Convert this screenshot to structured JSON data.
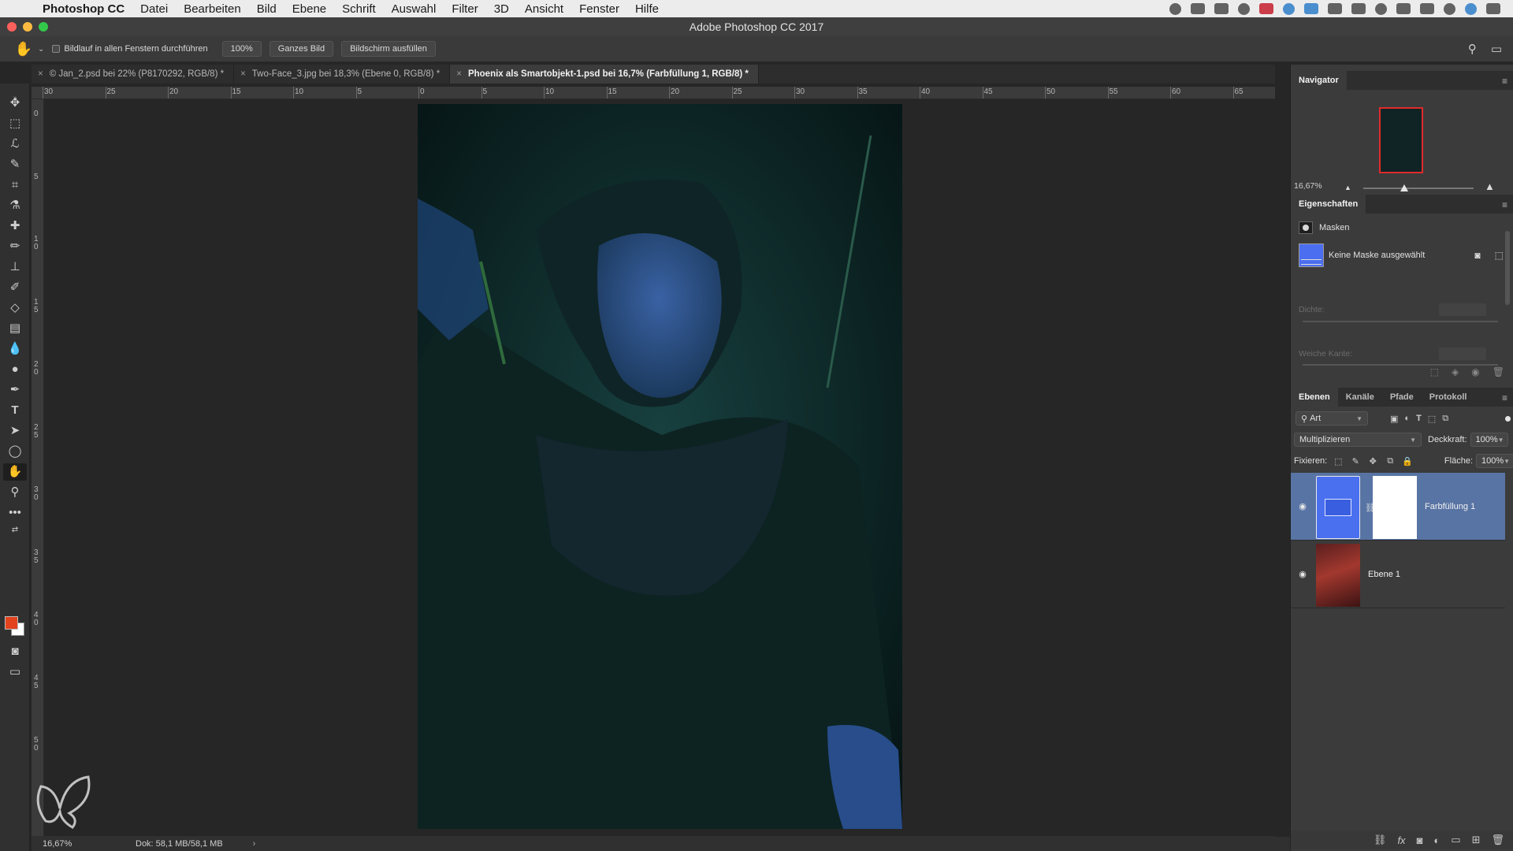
{
  "menubar": {
    "apple": "",
    "app_name": "Photoshop CC",
    "items": [
      "Datei",
      "Bearbeiten",
      "Bild",
      "Ebene",
      "Schrift",
      "Auswahl",
      "Filter",
      "3D",
      "Ansicht",
      "Fenster",
      "Hilfe"
    ]
  },
  "window": {
    "title": "Adobe Photoshop CC 2017"
  },
  "options": {
    "scroll_all_label": "Bildlauf in allen Fenstern durchführen",
    "zoom_btn": "100%",
    "fit_btn": "Ganzes Bild",
    "fill_btn": "Bildschirm ausfüllen"
  },
  "tabs": [
    {
      "label": "© Jan_2.psd bei 22% (P8170292, RGB/8) *",
      "active": false
    },
    {
      "label": "Two-Face_3.jpg bei 18,3% (Ebene 0, RGB/8) *",
      "active": false
    },
    {
      "label": "Phoenix als Smartobjekt-1.psd bei 16,7% (Farbfüllung 1, RGB/8) *",
      "active": true
    }
  ],
  "ruler": {
    "h_labels": [
      "30",
      "25",
      "20",
      "15",
      "10",
      "5",
      "0",
      "5",
      "10",
      "15",
      "20",
      "25",
      "30",
      "35",
      "40",
      "45",
      "50",
      "55",
      "60",
      "65"
    ],
    "v_labels": [
      "0",
      "5",
      "10",
      "15",
      "20",
      "25",
      "30",
      "35",
      "40",
      "45",
      "50"
    ]
  },
  "status": {
    "zoom": "16,67%",
    "doc": "Dok: 58,1 MB/58,1 MB",
    "arrow": "›"
  },
  "navigator": {
    "title": "Navigator",
    "zoom": "16,67%"
  },
  "properties": {
    "title": "Eigenschaften",
    "section": "Masken",
    "mask_status": "Keine Maske ausgewählt",
    "density_label": "Dichte:",
    "feather_label": "Weiche Kante:"
  },
  "layers_panel": {
    "tabs": [
      "Ebenen",
      "Kanäle",
      "Pfade",
      "Protokoll"
    ],
    "filter": "Art",
    "blend_mode": "Multiplizieren",
    "opacity_label": "Deckkraft:",
    "opacity_value": "100%",
    "lock_label": "Fixieren:",
    "fill_label": "Fläche:",
    "fill_value": "100%",
    "layers": [
      {
        "name": "Farbfüllung 1",
        "selected": true
      },
      {
        "name": "Ebene 1",
        "selected": false
      }
    ]
  },
  "colors": {
    "foreground": "#e2431d",
    "background": "#ffffff",
    "fill_layer": "#4b6ef0",
    "selection": "#5874a4"
  }
}
